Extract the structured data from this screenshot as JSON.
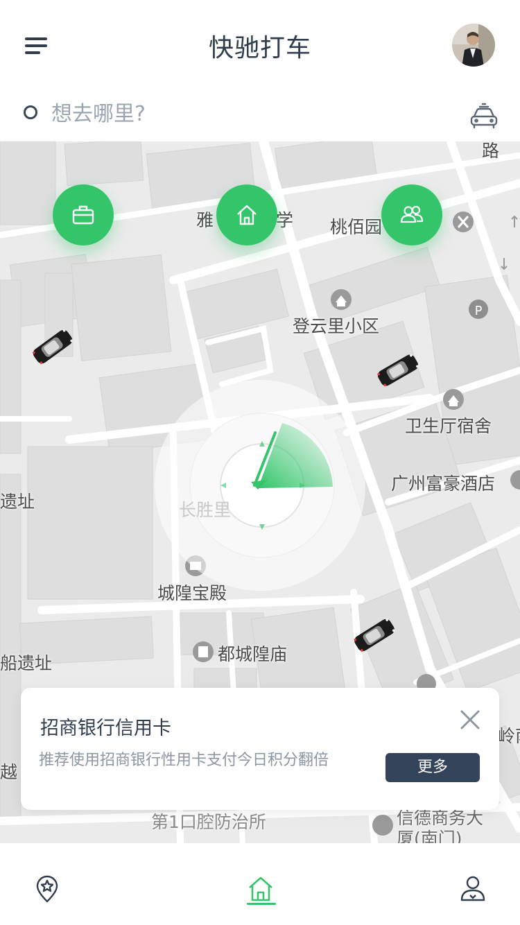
{
  "header": {
    "title": "快驰打车",
    "menu_icon": "menu-icon",
    "avatar_icon": "user-avatar"
  },
  "search": {
    "placeholder": "想去哪里?",
    "taxi_icon": "taxi-icon"
  },
  "shortcuts": [
    {
      "name": "work",
      "icon": "briefcase-icon"
    },
    {
      "name": "home",
      "icon": "home-icon"
    },
    {
      "name": "friends",
      "icon": "group-icon"
    }
  ],
  "map": {
    "labels": {
      "ya": "雅",
      "xue": "学",
      "taobai": "桃佰园",
      "dengyunli": "登云里小区",
      "weisheng": "卫生厅宿舍",
      "fuhao": "广州富豪酒店",
      "yizhi_left": "遗址",
      "changsheng": "长胜里",
      "chenghuang_bao": "城隍宝殿",
      "du_chenghuang": "都城隍庙",
      "chuan_yizhi": "船遗址",
      "yue": "越",
      "ling": "岭南",
      "lu": "路",
      "kouqiang": "第1口腔防治所",
      "xinde_1": "信德商务大",
      "xinde_2": "厦(南门)"
    },
    "radar_icon": "compass-radar-icon",
    "car_icon": "car-icon"
  },
  "promo": {
    "title": "招商银行信用卡",
    "description": "推荐使用招商银行性用卡支付今日积分翻倍",
    "more_label": "更多",
    "close_icon": "close-icon"
  },
  "bottom_nav": [
    {
      "name": "favorites",
      "icon": "location-star-icon"
    },
    {
      "name": "home",
      "icon": "home-icon",
      "active": true
    },
    {
      "name": "profile",
      "icon": "driver-profile-icon"
    }
  ],
  "colors": {
    "accent": "#34c56b",
    "dark": "#33435a",
    "text": "#2f3d4c",
    "muted": "#9aa5b1"
  }
}
